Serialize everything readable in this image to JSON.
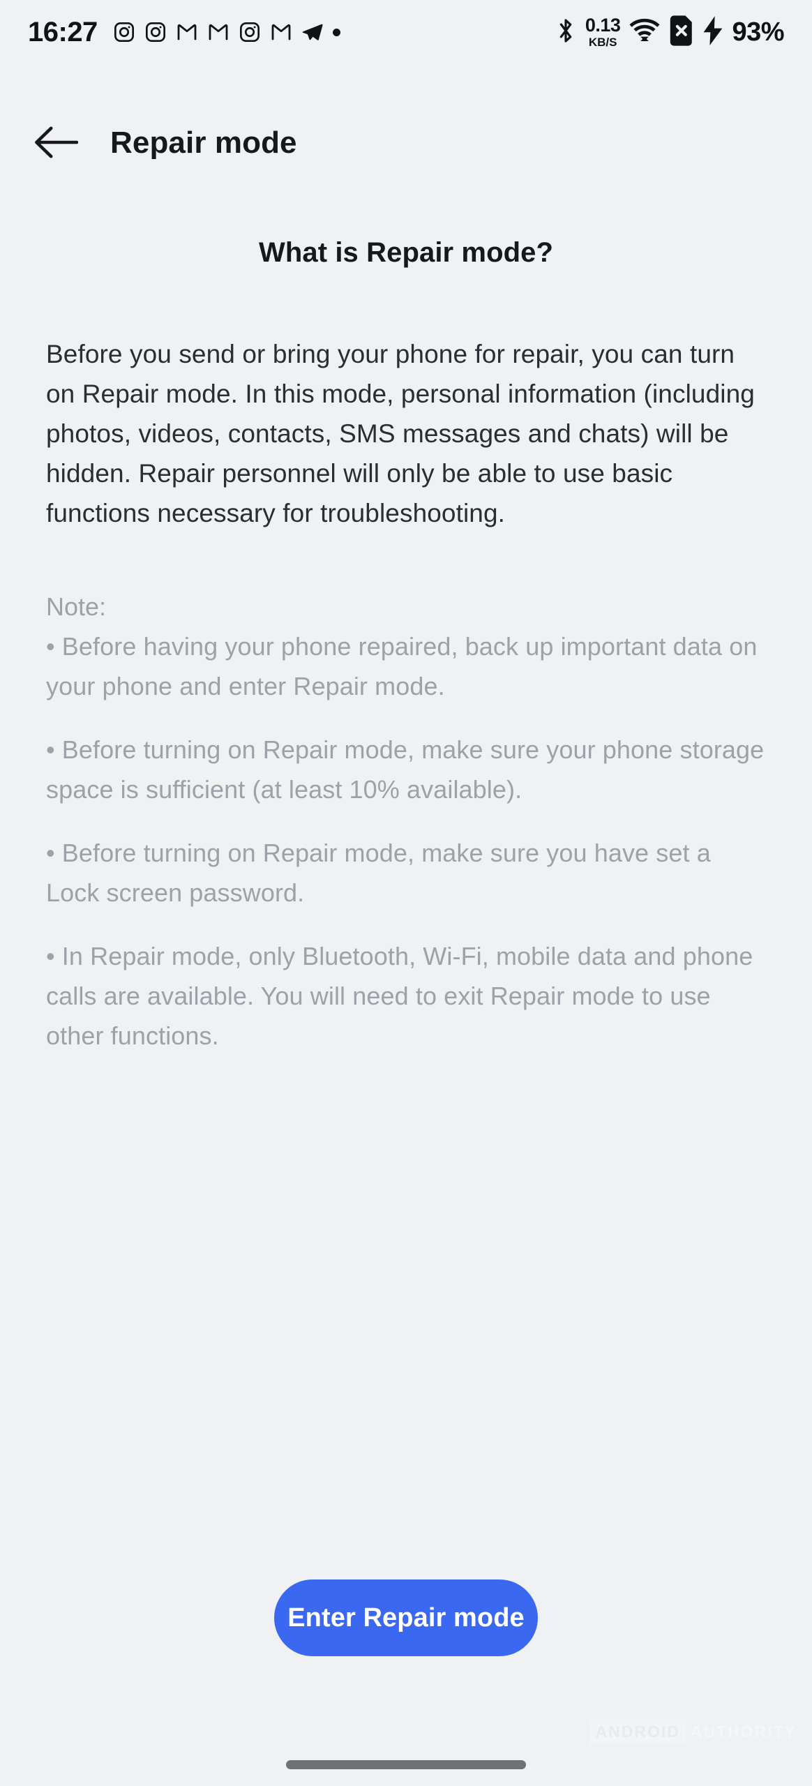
{
  "status_bar": {
    "clock": "16:27",
    "notification_icons": [
      "instagram-icon",
      "instagram-icon",
      "gmail-icon",
      "gmail-icon",
      "instagram-icon",
      "gmail-icon",
      "telegram-icon",
      "dot-icon"
    ],
    "bluetooth_icon": "bluetooth-icon",
    "network_speed_value": "0.13",
    "network_speed_unit": "KB/S",
    "wifi_icon": "wifi-icon",
    "sim_icon": "sim-card-off-icon",
    "charging_icon": "charging-bolt-icon",
    "battery_percent": "93%"
  },
  "app_bar": {
    "back_icon": "back-arrow-icon",
    "title": "Repair mode"
  },
  "main": {
    "heading": "What is Repair mode?",
    "intro": "Before you send or bring your phone for repair, you can turn on Repair mode. In this mode, personal information (including photos, videos, contacts, SMS messages and chats) will be hidden. Repair personnel will only be able to use basic functions necessary for troubleshooting.",
    "note_label": "Note:",
    "notes": [
      "• Before having your phone repaired, back up important data on your phone and enter Repair mode.",
      "• Before turning on Repair mode, make sure your phone storage space is sufficient (at least 10% available).",
      "• Before turning on Repair mode, make sure you have set a Lock screen password.",
      "• In Repair mode, only Bluetooth, Wi-Fi, mobile data and phone calls are available. You will need to exit Repair mode to use other functions."
    ]
  },
  "primary_button": {
    "label": "Enter Repair mode"
  },
  "watermark": {
    "badge": "ANDROID",
    "text": "AUTHORITY"
  },
  "colors": {
    "background": "#F0F1F3",
    "accent": "#3B68F0",
    "primary_text": "#16181C",
    "body_text": "#2A2D33",
    "muted_text": "#9DA1A8",
    "gesture_bar": "#6E7175"
  }
}
